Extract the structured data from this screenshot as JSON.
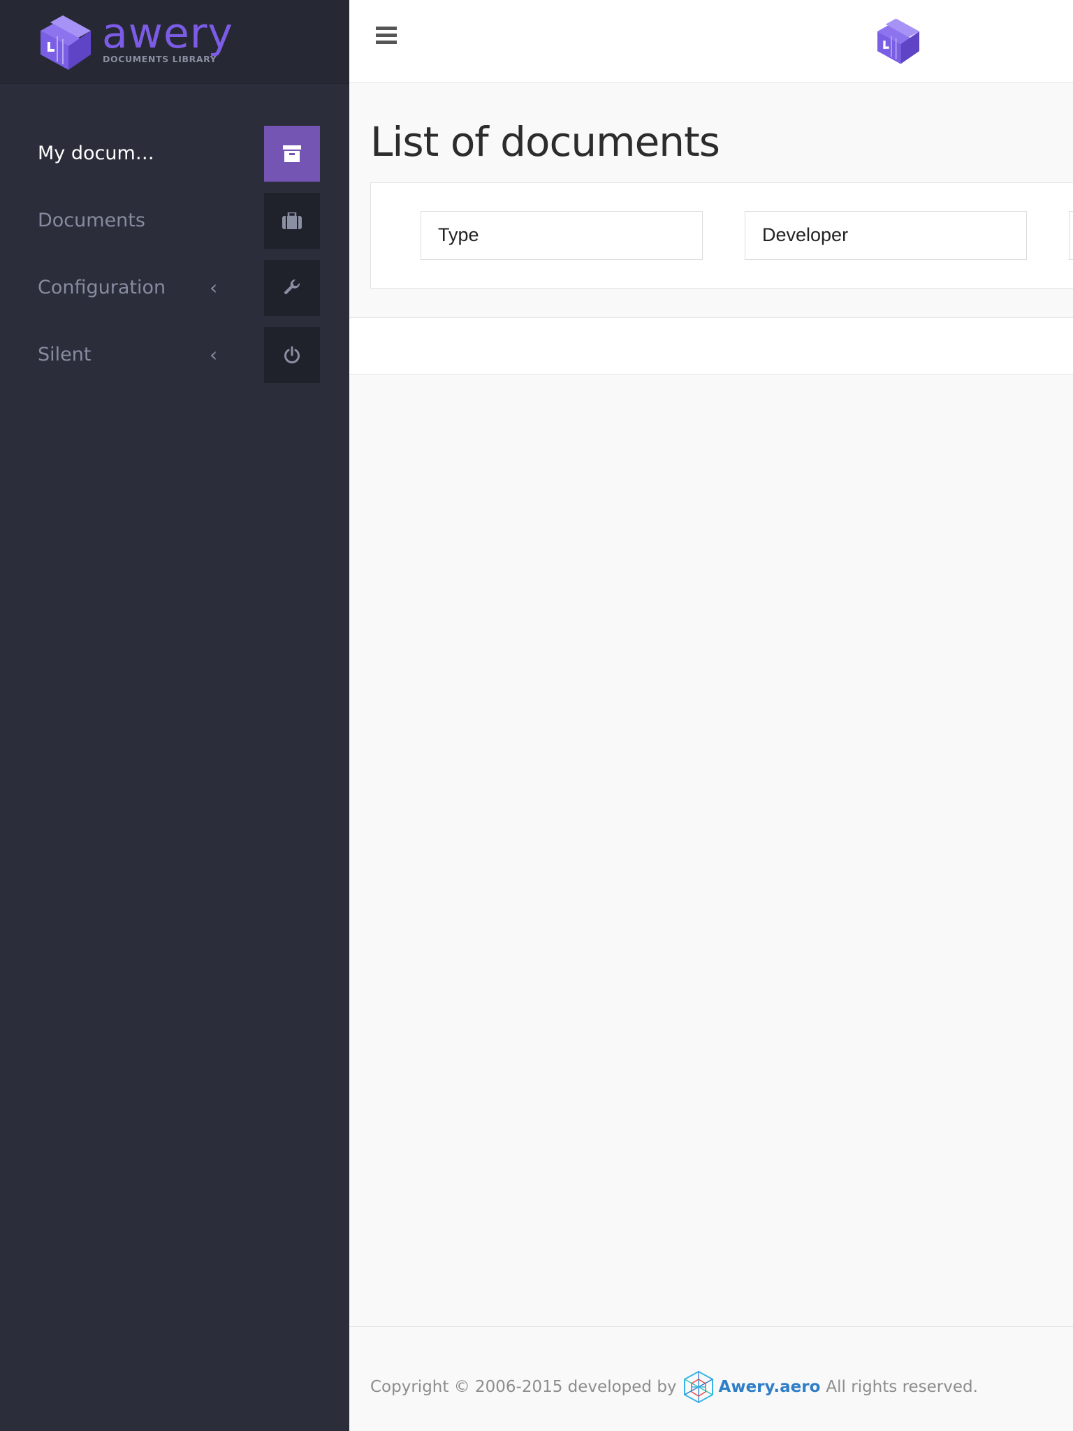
{
  "brand": {
    "name": "awery",
    "subtitle": "DOCUMENTS LIBRARY",
    "accent_color": "#7c5ce6"
  },
  "sidebar": {
    "items": [
      {
        "label": "My docum…",
        "icon": "archive-icon",
        "active": true,
        "has_submenu": false
      },
      {
        "label": "Documents",
        "icon": "briefcase-icon",
        "active": false,
        "has_submenu": false
      },
      {
        "label": "Configuration",
        "icon": "wrench-icon",
        "active": false,
        "has_submenu": true
      },
      {
        "label": "Silent",
        "icon": "power-icon",
        "active": false,
        "has_submenu": true
      }
    ],
    "active_color": "#7455b3"
  },
  "header": {
    "menu_icon": "hamburger-icon"
  },
  "main": {
    "title": "List of documents",
    "filters": [
      {
        "value": "Type"
      },
      {
        "value": "Developer"
      }
    ]
  },
  "footer": {
    "prefix": "Copyright © 2006-2015 developed by",
    "link": "Awery.aero",
    "suffix": "All rights reserved.",
    "link_color": "#2f7ec7"
  }
}
